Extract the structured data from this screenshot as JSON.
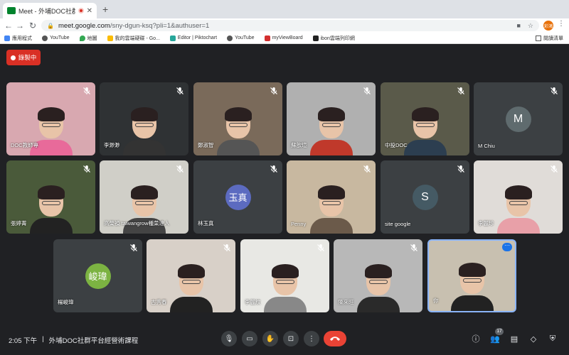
{
  "browser": {
    "tab_title": "Meet - 外埔DOC社群平台經",
    "url_host": "meet.google.com",
    "url_path": "/sny-dgun-ksq?pli=1&authuser=1",
    "profile_initial": "彩鴻"
  },
  "bookmarks": {
    "items": [
      "應用程式",
      "YouTube",
      "地圖",
      "我的雲端硬碟 - Go...",
      "Editor | Piktochart",
      "YouTube",
      "myViewBoard",
      "ibon雲端列印網"
    ],
    "reading_list": "閱讀清單"
  },
  "recording_label": "錄製中",
  "participants": [
    {
      "name": "DOC教師專",
      "bg": "#d8a8b0"
    },
    {
      "name": "李渺渺",
      "bg": "#2f3234"
    },
    {
      "name": "鄭淑智",
      "bg": "#7a6a5a"
    },
    {
      "name": "蘇歆瑄",
      "bg": "#b0b0b0"
    },
    {
      "name": "中投DOC",
      "bg": "#5a5a4a"
    },
    {
      "name": "M Chiu",
      "avatar": "M",
      "avatar_color": "#5f6b6e"
    },
    {
      "name": "張婷菁",
      "bg": "#4a5a3a"
    },
    {
      "name": "高榮禎 taiwangrow種菜達人",
      "bg": "#d0cfc8"
    },
    {
      "name": "林玉真",
      "avatar": "玉真",
      "avatar_color": "#5c6bc0"
    },
    {
      "name": "Penny",
      "bg": "#c8b8a0"
    },
    {
      "name": "site google",
      "avatar": "S",
      "avatar_color": "#455a64"
    },
    {
      "name": "李麗珍",
      "bg": "#e0dcd8"
    },
    {
      "name": "楊峻瑋",
      "avatar": "峻瑋",
      "avatar_color": "#7cb342"
    },
    {
      "name": "古秀春",
      "bg": "#d8d0c8"
    },
    {
      "name": "李麗紋",
      "bg": "#e8e8e4"
    },
    {
      "name": "陳來旺",
      "bg": "#b8b8b8"
    },
    {
      "name": "你",
      "bg": "#c8c0b0"
    }
  ],
  "meeting": {
    "time": "2:05 下午",
    "separator": "|",
    "title": "外埔DOC社群平台經營術課程"
  },
  "people_count": "17"
}
